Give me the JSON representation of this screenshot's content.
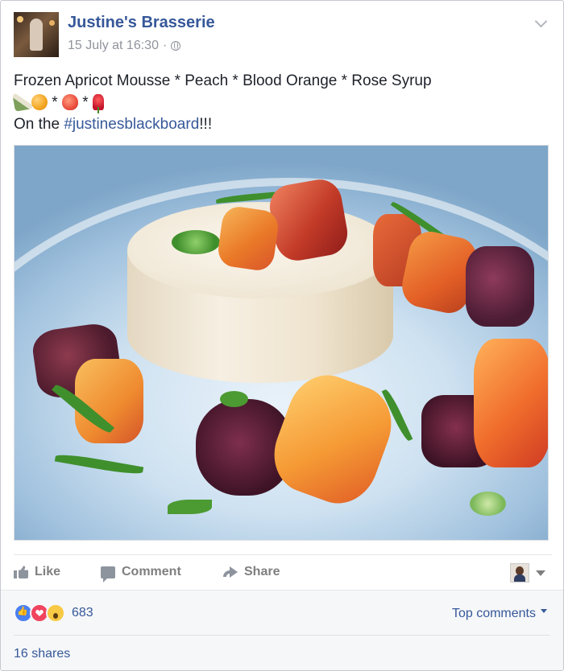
{
  "post": {
    "page_name": "Justine's Brasserie",
    "timestamp": "15 July at 16:30",
    "meta_separator": "·",
    "audience_icon": "globe-icon",
    "text_line1": "Frozen Apricot Mousse * Peach * Blood Orange * Rose Syrup",
    "emoji_separator": "*",
    "emojis": [
      "bottle-icon",
      "orange-icon",
      "peach-icon",
      "rose-icon"
    ],
    "text_line3_prefix": "On the ",
    "hashtag": "#justinesblackboard",
    "text_line3_suffix": "!!!",
    "image_description_icon": "dessert-photo"
  },
  "actions": {
    "like_label": "Like",
    "comment_label": "Comment",
    "share_label": "Share"
  },
  "stats": {
    "reaction_icons": [
      "like-reaction-icon",
      "love-reaction-icon",
      "wow-reaction-icon"
    ],
    "reaction_count": "683",
    "top_comments_label": "Top comments",
    "shares_label": "16 shares"
  },
  "colors": {
    "link": "#365899",
    "text": "#1d2129",
    "muted": "#90949c"
  }
}
